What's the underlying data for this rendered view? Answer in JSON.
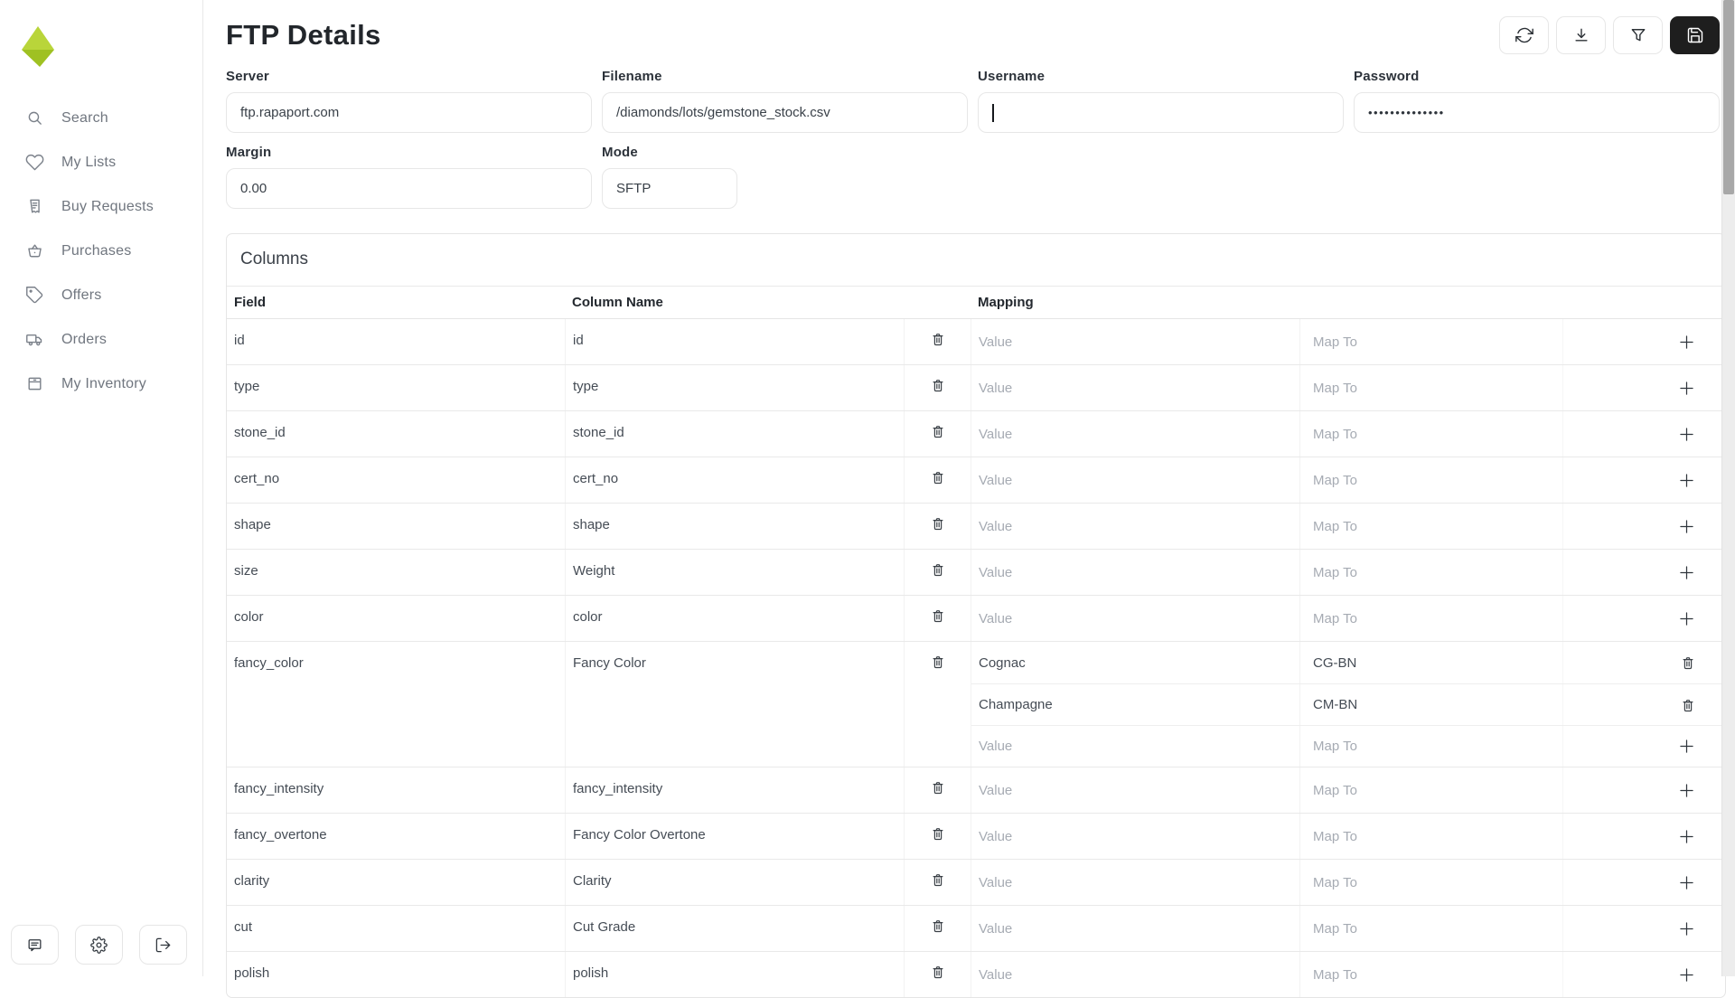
{
  "brand": {
    "logo": "diamond-logo",
    "color_top": "#b9d53a",
    "color_bottom": "#9fc122"
  },
  "sidebar": {
    "items": [
      {
        "label": "Search",
        "icon": "search-icon"
      },
      {
        "label": "My Lists",
        "icon": "heart-icon"
      },
      {
        "label": "Buy Requests",
        "icon": "receipt-icon"
      },
      {
        "label": "Purchases",
        "icon": "basket-icon"
      },
      {
        "label": "Offers",
        "icon": "tag-icon"
      },
      {
        "label": "Orders",
        "icon": "truck-icon"
      },
      {
        "label": "My Inventory",
        "icon": "box-icon"
      }
    ],
    "footer": [
      {
        "name": "chat-button",
        "icon": "chat-icon"
      },
      {
        "name": "settings-button",
        "icon": "gear-icon"
      },
      {
        "name": "logout-button",
        "icon": "logout-icon"
      }
    ]
  },
  "header": {
    "title": "FTP Details",
    "actions": [
      {
        "name": "refresh-button",
        "icon": "refresh-icon",
        "style": "light"
      },
      {
        "name": "download-button",
        "icon": "download-icon",
        "style": "light"
      },
      {
        "name": "filter-button",
        "icon": "filter-icon",
        "style": "light"
      },
      {
        "name": "save-button",
        "icon": "save-icon",
        "style": "dark"
      }
    ],
    "save_button_bg": "#1e1e1e"
  },
  "form": {
    "server": {
      "label": "Server",
      "value": "ftp.rapaport.com"
    },
    "filename": {
      "label": "Filename",
      "value": "/diamonds/lots/gemstone_stock.csv"
    },
    "username": {
      "label": "Username",
      "value": ""
    },
    "password": {
      "label": "Password",
      "value": "••••••••••••••"
    },
    "margin": {
      "label": "Margin",
      "value": "0.00"
    },
    "mode": {
      "label": "Mode",
      "value": "SFTP"
    }
  },
  "columns_panel": {
    "title": "Columns",
    "headers": {
      "field": "Field",
      "column_name": "Column Name",
      "mapping": "Mapping"
    },
    "placeholders": {
      "value": "Value",
      "map_to": "Map To"
    },
    "rows": [
      {
        "field": "id",
        "column_name": "id",
        "mappings": []
      },
      {
        "field": "type",
        "column_name": "type",
        "mappings": []
      },
      {
        "field": "stone_id",
        "column_name": "stone_id",
        "mappings": []
      },
      {
        "field": "cert_no",
        "column_name": "cert_no",
        "mappings": []
      },
      {
        "field": "shape",
        "column_name": "shape",
        "mappings": []
      },
      {
        "field": "size",
        "column_name": "Weight",
        "mappings": []
      },
      {
        "field": "color",
        "column_name": "color",
        "mappings": []
      },
      {
        "field": "fancy_color",
        "column_name": "Fancy Color",
        "mappings": [
          {
            "value": "Cognac",
            "map_to": "CG-BN"
          },
          {
            "value": "Champagne",
            "map_to": "CM-BN"
          }
        ]
      },
      {
        "field": "fancy_intensity",
        "column_name": "fancy_intensity",
        "mappings": []
      },
      {
        "field": "fancy_overtone",
        "column_name": "Fancy Color Overtone",
        "mappings": []
      },
      {
        "field": "clarity",
        "column_name": "Clarity",
        "mappings": []
      },
      {
        "field": "cut",
        "column_name": "Cut Grade",
        "mappings": []
      },
      {
        "field": "polish",
        "column_name": "polish",
        "mappings": []
      }
    ]
  },
  "scrollbar": {
    "thumb_color": "#a8a8a8",
    "track_color": "#ededed"
  }
}
